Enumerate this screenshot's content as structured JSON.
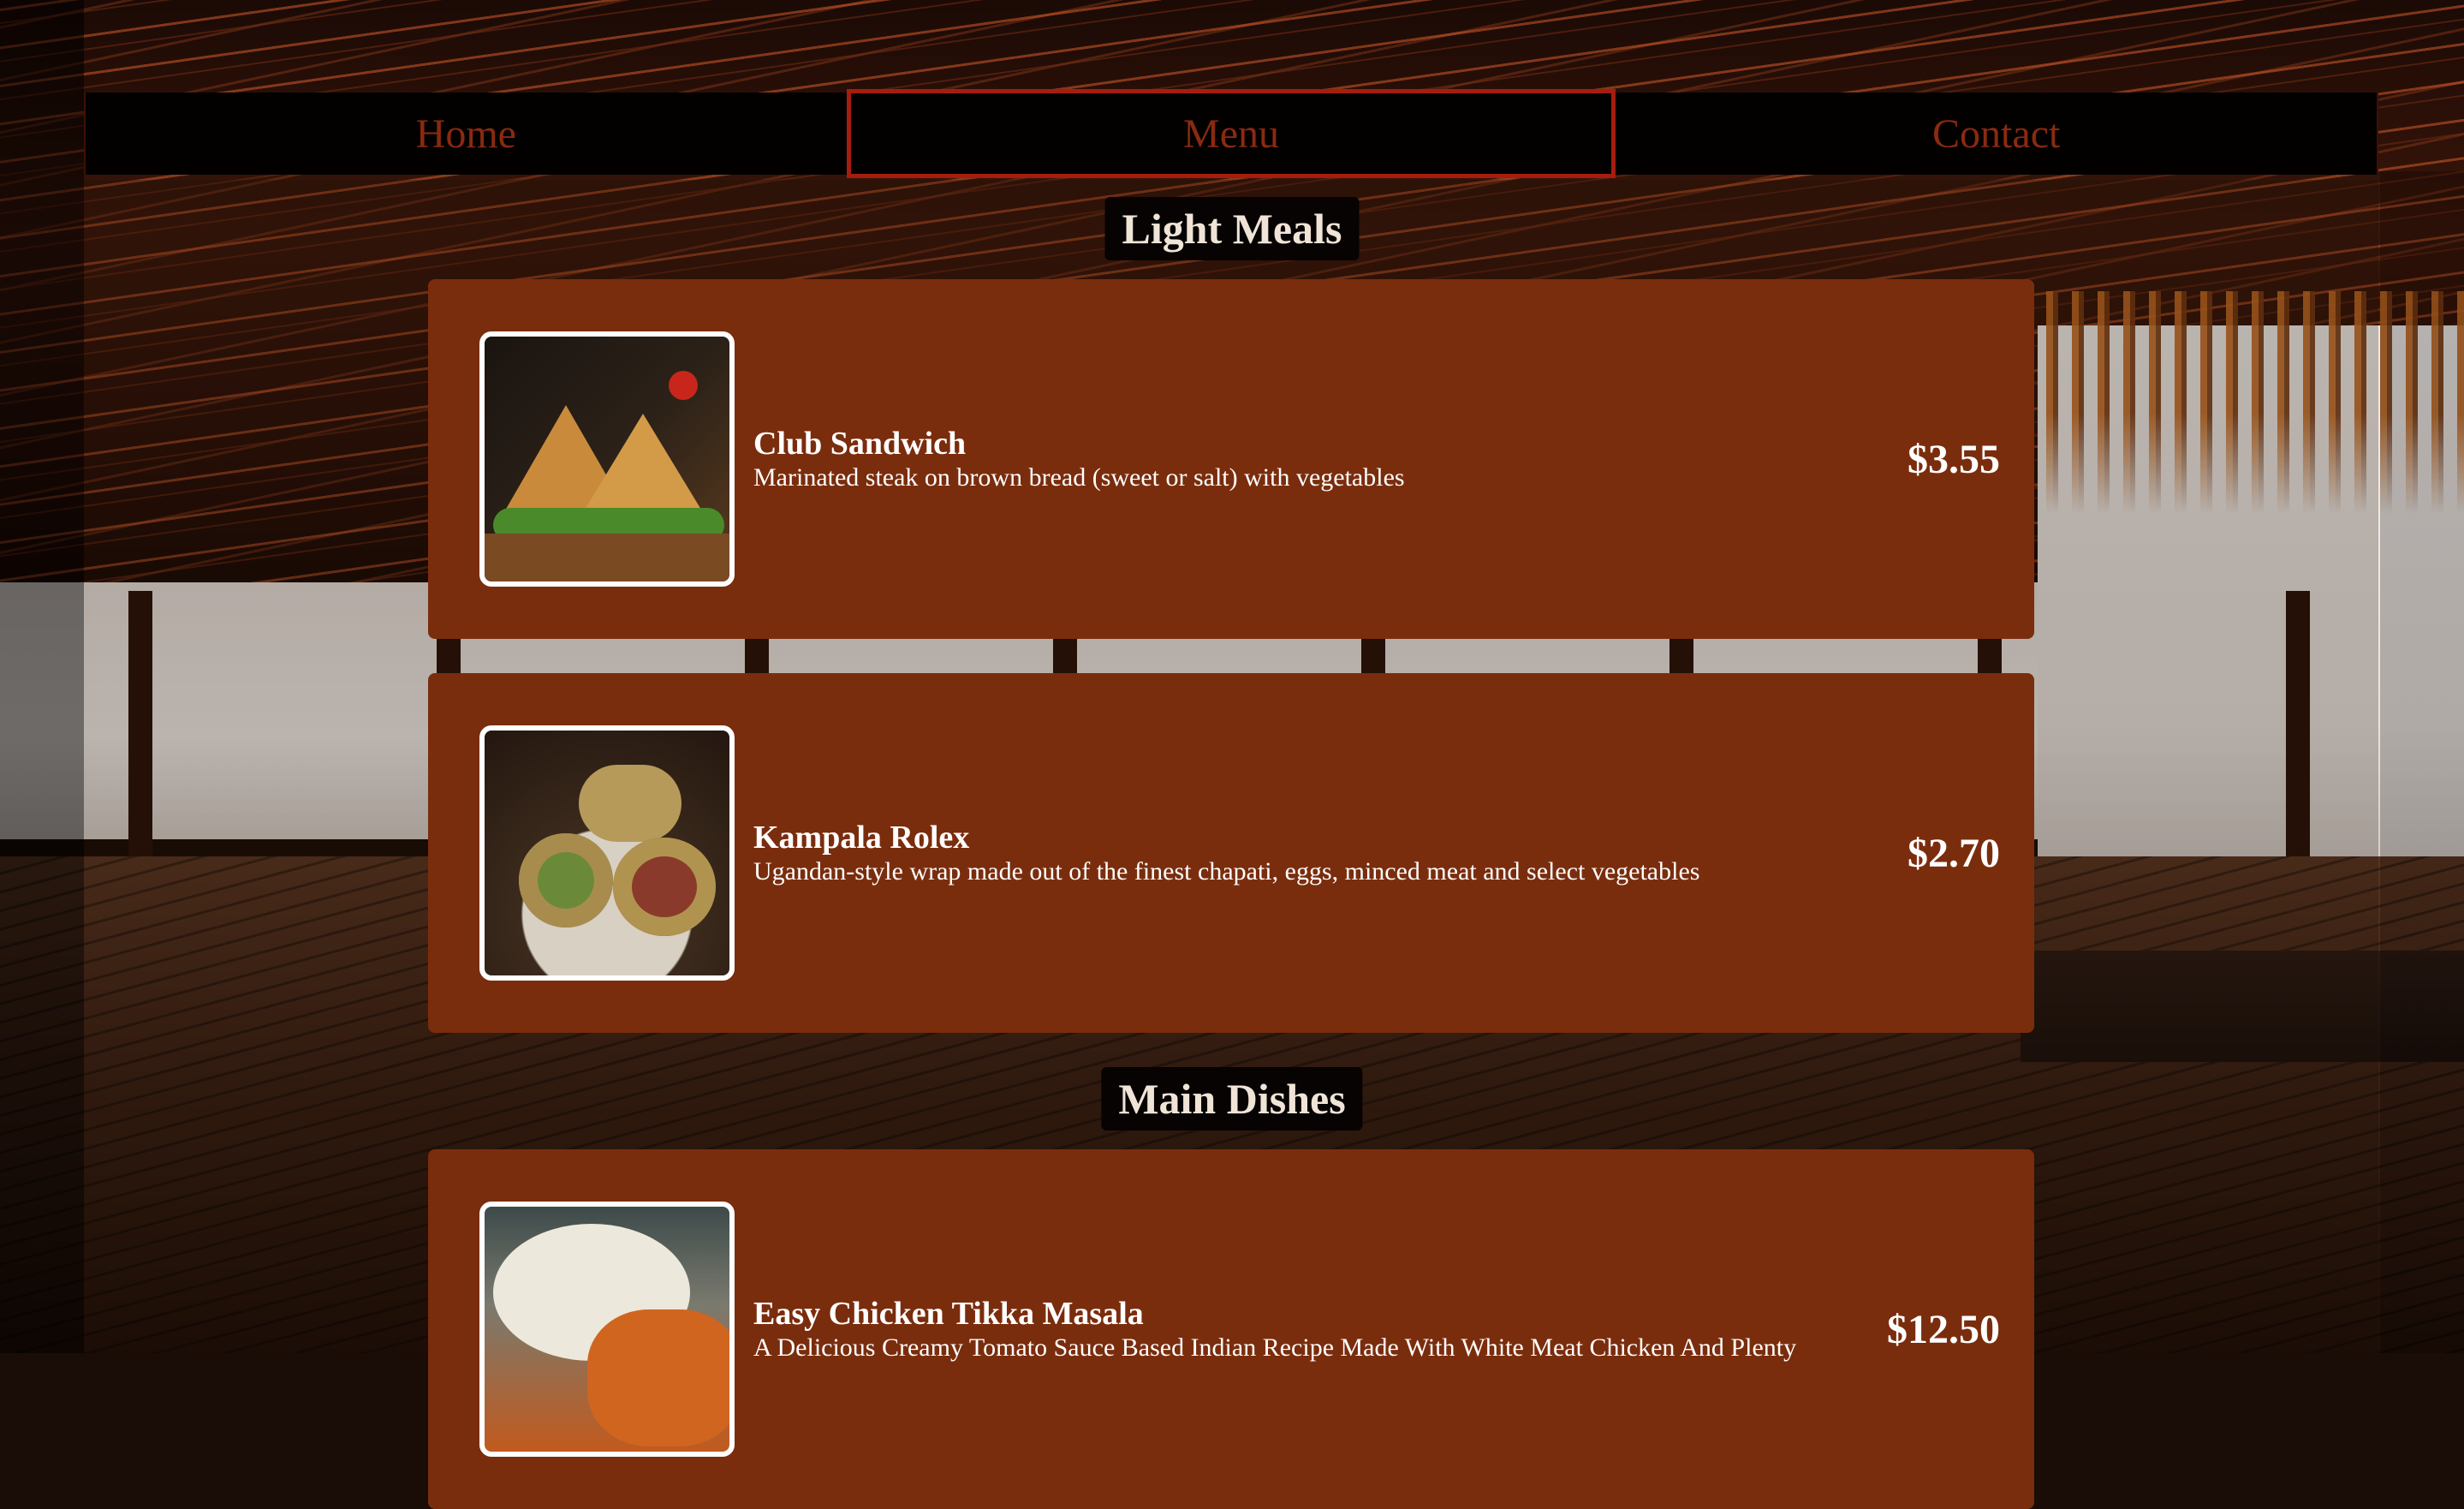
{
  "nav": {
    "items": [
      {
        "label": "Home",
        "active": false
      },
      {
        "label": "Menu",
        "active": true
      },
      {
        "label": "Contact",
        "active": false
      }
    ]
  },
  "sections": [
    {
      "title": "Light Meals",
      "items": [
        {
          "name": "Club Sandwich",
          "description": "Marinated steak on brown bread (sweet or salt) with vegetables",
          "price": "$3.55"
        },
        {
          "name": "Kampala Rolex",
          "description": "Ugandan-style wrap made out of the finest chapati, eggs, minced meat and select vegetables",
          "price": "$2.70"
        }
      ]
    },
    {
      "title": "Main Dishes",
      "items": [
        {
          "name": "Easy Chicken Tikka Masala",
          "description": "A Delicious Creamy Tomato Sauce Based Indian Recipe Made With White Meat Chicken And Plenty",
          "price": "$12.50"
        }
      ]
    }
  ],
  "colors": {
    "nav_text": "#8a2a10",
    "nav_active_border": "#a61d0f",
    "card_background": "#7a2d0d",
    "section_title_background": "#060302"
  }
}
